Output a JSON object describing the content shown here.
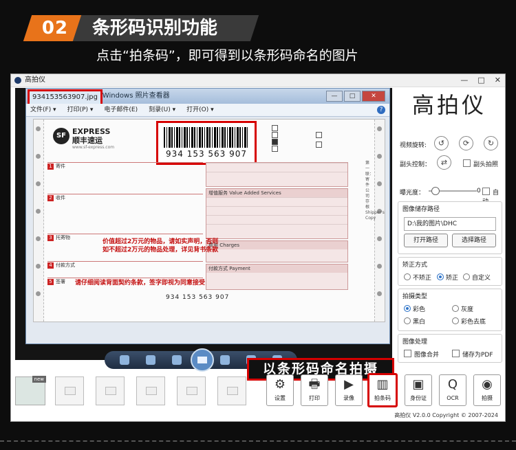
{
  "banner": {
    "number": "02",
    "title": "条形码识别功能",
    "subtitle": "点击“拍条码”，即可得到以条形码命名的图片"
  },
  "app": {
    "title": "高拍仪",
    "window_controls": [
      "—",
      "□",
      "✕"
    ]
  },
  "viewer": {
    "filename": "934153563907.jpg",
    "title": "- Windows 照片查看器",
    "menu": [
      "文件(F) ▾",
      "打印(P) ▾",
      "电子邮件(E)",
      "刻录(U) ▾",
      "打开(O) ▾"
    ],
    "help": "?"
  },
  "document": {
    "brand_en": "EXPRESS",
    "brand_cn": "顺丰速运",
    "logo": "SF",
    "site": "www.sf-express.com",
    "barcode_number": "934 153 563 907",
    "sender_label": "寄件",
    "receiver_label": "收件",
    "section_labels": [
      "寄件",
      "收件",
      "托寄物",
      "付款方式",
      "签署"
    ],
    "right_labels": [
      "增值服务 Value Added Services",
      "费用 Charges",
      "付款方式 Payment"
    ],
    "red_notice_1": "价值超过2万元的物品，请如实声明，否则",
    "red_notice_2": "如不超过2万元的物品处理，详见背书条款",
    "red_notice_3": "请仔细阅读背面契约条款，签字即视为同意接受",
    "bottom_number": "934 153 563 907",
    "side_text": "第一联：寄件公司存根 Shipper's Copy"
  },
  "capture_label": "以条形码命名拍摄",
  "panel": {
    "title": "高拍仪",
    "rotate_label": "视频旋转:",
    "rotate_icons": [
      "↺",
      "⟳",
      "↻"
    ],
    "head_control_label": "副头控制：",
    "head_capture_label": "副头拍照",
    "exposure_label": "曝光度：",
    "exposure_value": "0",
    "auto_label": "自动",
    "save_path_group": "图像储存路径",
    "save_path": "D:\\我的图片\\DHC",
    "open_path": "打开路径",
    "select_path": "选择路径",
    "correction_group": "矫正方式",
    "correction_options": [
      "不矫正",
      "矫正",
      "自定义"
    ],
    "correction_selected": 1,
    "capture_type_group": "拍摄类型",
    "capture_types": [
      "彩色",
      "灰度",
      "黑白",
      "彩色去底"
    ],
    "capture_type_selected": 0,
    "image_process_group": "图像处理",
    "image_merge": "图像合并",
    "save_pdf": "储存为PDF"
  },
  "toolbar": {
    "thumb_new": "new",
    "buttons": [
      {
        "label": "设置",
        "icon": "⚙"
      },
      {
        "label": "打印",
        "icon": "🖶"
      },
      {
        "label": "录像",
        "icon": "▶"
      },
      {
        "label": "拍条码",
        "icon": "▥"
      },
      {
        "label": "身份证",
        "icon": "▣"
      },
      {
        "label": "OCR",
        "icon": "Q"
      },
      {
        "label": "拍摄",
        "icon": "◉"
      }
    ]
  },
  "copyright": "高拍仪 V2.0.0 Copyright © 2007-2024",
  "colors": {
    "accent": "#e8731a",
    "highlight": "#d60000",
    "selected": "#2f74c8"
  }
}
